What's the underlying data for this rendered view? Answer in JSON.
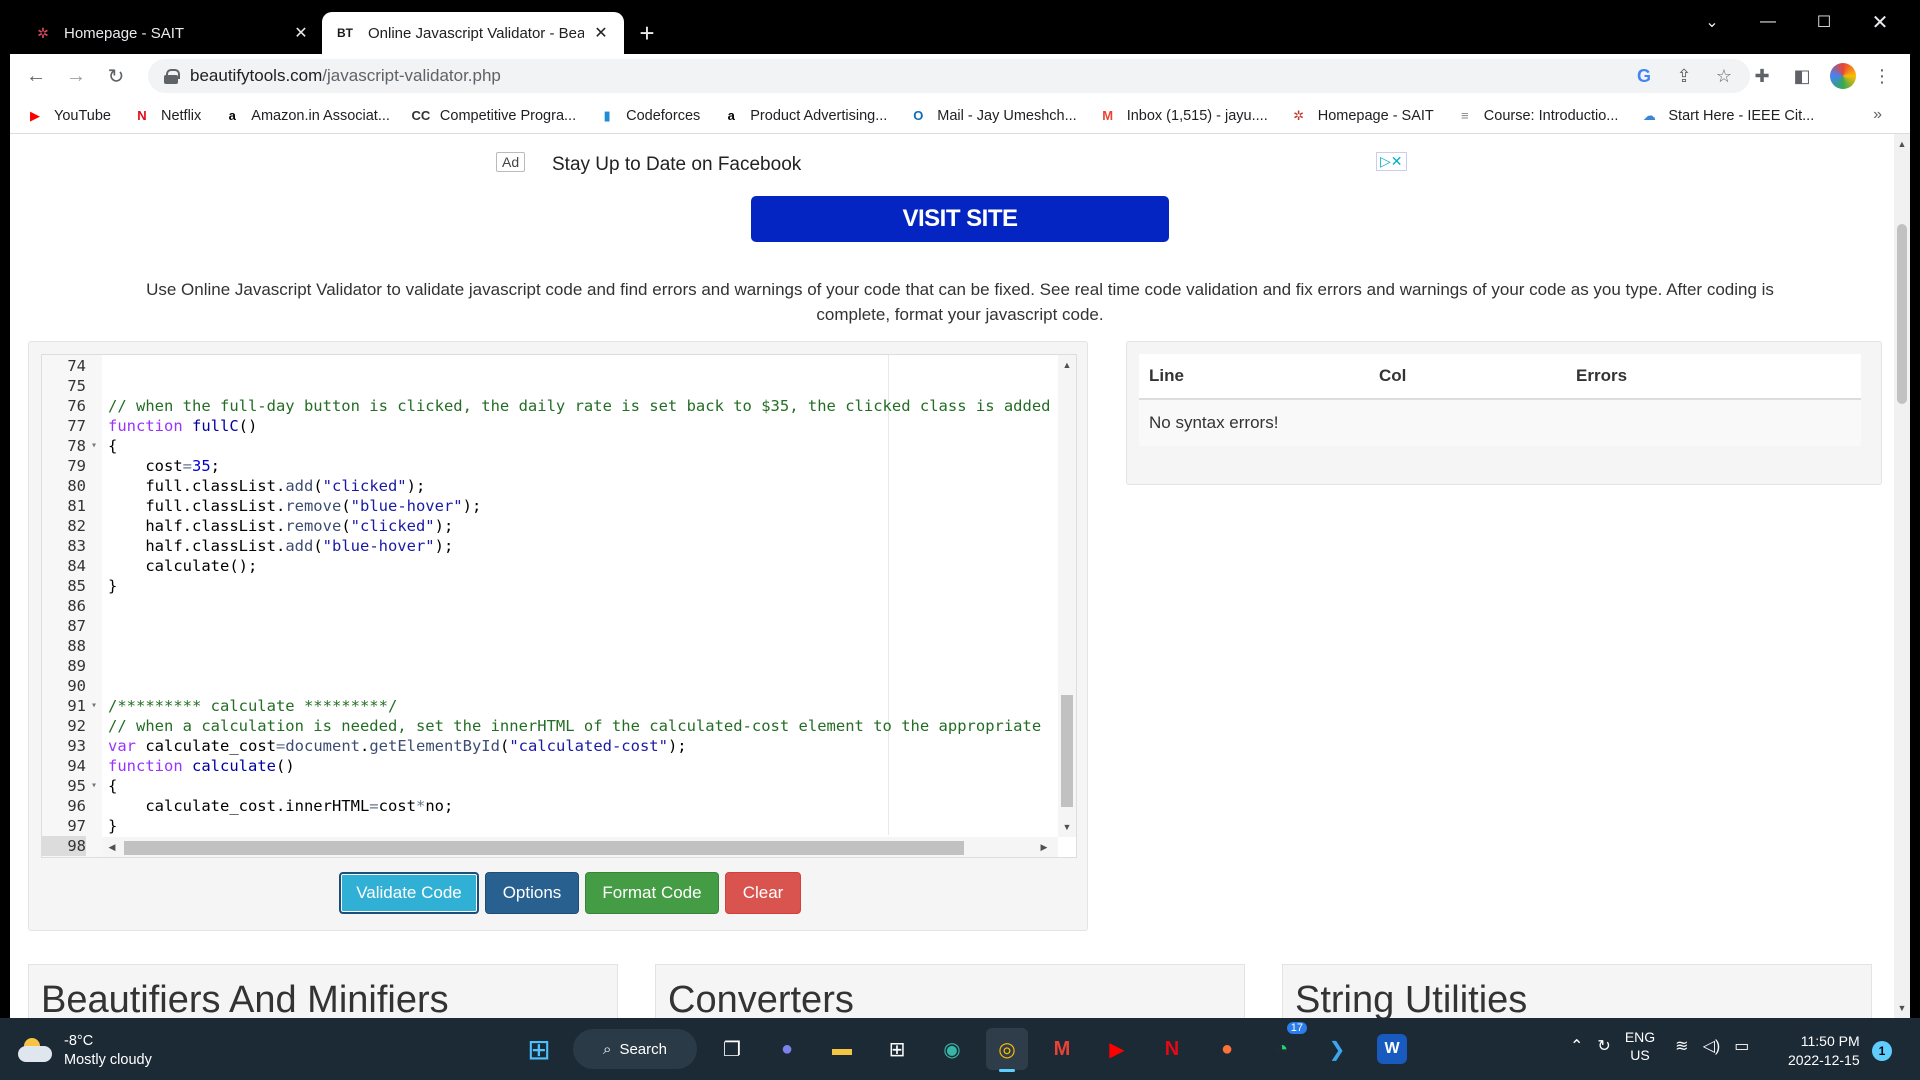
{
  "browser": {
    "tabs": [
      {
        "title": "Homepage - SAIT",
        "icon": "sait-icon"
      },
      {
        "title": "Online Javascript Validator - Beautify",
        "icon": "bt-icon",
        "favicon_text": "BT"
      }
    ],
    "url_host": "beautifytools.com",
    "url_path": "/javascript-validator.php",
    "bookmarks": [
      {
        "label": "YouTube",
        "icon_char": "▶",
        "color": "#ff0000"
      },
      {
        "label": "Netflix",
        "icon_char": "N",
        "color": "#e50914"
      },
      {
        "label": "Amazon.in Associat...",
        "icon_char": "a",
        "color": "#000000"
      },
      {
        "label": "Competitive Progra...",
        "icon_char": "CC",
        "color": "#333333"
      },
      {
        "label": "Codeforces",
        "icon_char": "▮",
        "color": "#1f8dd6"
      },
      {
        "label": "Product Advertising...",
        "icon_char": "a",
        "color": "#000000"
      },
      {
        "label": "Mail - Jay Umeshch...",
        "icon_char": "O",
        "color": "#0f6cbd"
      },
      {
        "label": "Inbox (1,515) - jayu....",
        "icon_char": "M",
        "color": "#ea4335"
      },
      {
        "label": "Homepage - SAIT",
        "icon_char": "✲",
        "color": "#c0392b"
      },
      {
        "label": "Course: Introductio...",
        "icon_char": "≡",
        "color": "#888888"
      },
      {
        "label": "Start Here - IEEE Cit...",
        "icon_char": "☁",
        "color": "#3a86d4"
      }
    ],
    "more_label": "»"
  },
  "page": {
    "ad": {
      "tag": "Ad",
      "text": "Stay Up to Date on Facebook",
      "button": "VISIT SITE"
    },
    "description": "Use Online Javascript Validator to validate javascript code and find errors and warnings of your code that can be fixed. See real time code validation and fix errors and warnings of your code as you type. After coding is complete, format your javascript code.",
    "editor": {
      "lines": [
        {
          "n": "74",
          "fold": "",
          "html": ""
        },
        {
          "n": "75",
          "fold": "",
          "html": ""
        },
        {
          "n": "76",
          "fold": "",
          "html": "<span class=\"c-comment\">// when the full-day button is clicked, the daily rate is set back to $35, the clicked class is added</span>"
        },
        {
          "n": "77",
          "fold": "",
          "html": "<span class=\"c-kw\">function</span> <span class=\"c-fn\">fullC</span>()"
        },
        {
          "n": "78",
          "fold": "▾",
          "html": "{"
        },
        {
          "n": "79",
          "fold": "",
          "html": "    cost<span class=\"c-op\">=</span><span class=\"c-num\">35</span>;"
        },
        {
          "n": "80",
          "fold": "",
          "html": "    full.classList.<span class=\"c-call\">add</span>(<span class=\"c-str\">\"clicked\"</span>);"
        },
        {
          "n": "81",
          "fold": "",
          "html": "    full.classList.<span class=\"c-call\">remove</span>(<span class=\"c-str\">\"blue-hover\"</span>);"
        },
        {
          "n": "82",
          "fold": "",
          "html": "    half.classList.<span class=\"c-call\">remove</span>(<span class=\"c-str\">\"clicked\"</span>);"
        },
        {
          "n": "83",
          "fold": "",
          "html": "    half.classList.<span class=\"c-call\">add</span>(<span class=\"c-str\">\"blue-hover\"</span>);"
        },
        {
          "n": "84",
          "fold": "",
          "html": "    calculate();"
        },
        {
          "n": "85",
          "fold": "",
          "html": "}"
        },
        {
          "n": "86",
          "fold": "",
          "html": ""
        },
        {
          "n": "87",
          "fold": "",
          "html": ""
        },
        {
          "n": "88",
          "fold": "",
          "html": ""
        },
        {
          "n": "89",
          "fold": "",
          "html": ""
        },
        {
          "n": "90",
          "fold": "",
          "html": ""
        },
        {
          "n": "91",
          "fold": "▾",
          "html": "<span class=\"c-comment\">/********* calculate *********/</span>"
        },
        {
          "n": "92",
          "fold": "",
          "html": "<span class=\"c-comment\">// when a calculation is needed, set the innerHTML of the calculated-cost element to the appropriate</span>"
        },
        {
          "n": "93",
          "fold": "",
          "html": "<span class=\"c-kw\">var</span> calculate_cost<span class=\"c-op\">=</span><span class=\"c-call\">document</span>.<span class=\"c-call\">getElementById</span>(<span class=\"c-str\">\"calculated-cost\"</span>);"
        },
        {
          "n": "94",
          "fold": "",
          "html": "<span class=\"c-kw\">function</span> <span class=\"c-fn\">calculate</span>()"
        },
        {
          "n": "95",
          "fold": "▾",
          "html": "{"
        },
        {
          "n": "96",
          "fold": "",
          "html": "    calculate_cost.innerHTML<span class=\"c-op\">=</span>cost<span class=\"c-op\">*</span>no;"
        },
        {
          "n": "97",
          "fold": "",
          "html": "}"
        },
        {
          "n": "98",
          "fold": "",
          "html": "",
          "current": true
        }
      ]
    },
    "buttons": {
      "validate": "Validate Code",
      "options": "Options",
      "format": "Format Code",
      "clear": "Clear"
    },
    "errors_table": {
      "headers": [
        "Line",
        "Col",
        "Errors"
      ],
      "message": "No syntax errors!"
    },
    "cards": [
      "Beautifiers And Minifiers",
      "Converters",
      "String Utilities"
    ]
  },
  "taskbar": {
    "temperature": "-8°C",
    "weather": "Mostly cloudy",
    "search": "Search",
    "whatsapp_badge": "17",
    "lang_top": "ENG",
    "lang_bottom": "US",
    "time": "11:50 PM",
    "date": "2022-12-15",
    "notifications": "1"
  }
}
